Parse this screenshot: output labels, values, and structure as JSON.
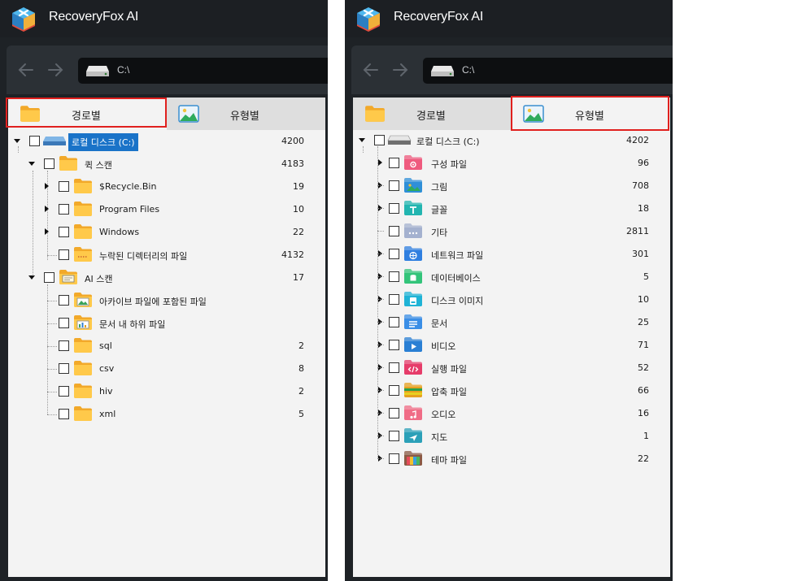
{
  "app": {
    "title": "RecoveryFox AI"
  },
  "path": {
    "text": "C:\\"
  },
  "tabs": {
    "by_path": "경로별",
    "by_type": "유형별"
  },
  "colors": {
    "highlight": "#e0201e",
    "selection": "#1a73c8",
    "folder": "#f5b82e"
  },
  "left_tree": {
    "root": {
      "label": "로컬 디스크 (C:)",
      "count": "4200"
    },
    "quick_scan": {
      "label": "퀵 스캔",
      "count": "4183"
    },
    "quick_items": [
      {
        "label": "$Recycle.Bin",
        "count": "19"
      },
      {
        "label": "Program Files",
        "count": "10"
      },
      {
        "label": "Windows",
        "count": "22"
      },
      {
        "label": "누락된 디렉터리의 파일",
        "count": "4132"
      }
    ],
    "ai_scan": {
      "label": "AI 스캔",
      "count": "17"
    },
    "ai_items": [
      {
        "label": "아카이브 파일에 포함된 파일",
        "count": ""
      },
      {
        "label": "문서 내 하위 파일",
        "count": ""
      },
      {
        "label": "sql",
        "count": "2"
      },
      {
        "label": "csv",
        "count": "8"
      },
      {
        "label": "hiv",
        "count": "2"
      },
      {
        "label": "xml",
        "count": "5"
      }
    ]
  },
  "right_tree": {
    "root": {
      "label": "로컬 디스크 (C:)",
      "count": "4202"
    },
    "items": [
      {
        "label": "구성 파일",
        "count": "96",
        "icon": "settings-folder-icon",
        "color": "#ef5a7e"
      },
      {
        "label": "그림",
        "count": "708",
        "icon": "picture-folder-icon",
        "color": "#2f8fd8"
      },
      {
        "label": "글꼴",
        "count": "18",
        "icon": "font-folder-icon",
        "color": "#22b5b0"
      },
      {
        "label": "기타",
        "count": "2811",
        "icon": "other-folder-icon",
        "color": "#a4b1cf"
      },
      {
        "label": "네트워크 파일",
        "count": "301",
        "icon": "network-folder-icon",
        "color": "#2f7fe0"
      },
      {
        "label": "데이터베이스",
        "count": "5",
        "icon": "database-folder-icon",
        "color": "#33c47a"
      },
      {
        "label": "디스크 이미지",
        "count": "10",
        "icon": "disk-image-folder-icon",
        "color": "#1fb3d6"
      },
      {
        "label": "문서",
        "count": "25",
        "icon": "document-folder-icon",
        "color": "#3a8ee6"
      },
      {
        "label": "비디오",
        "count": "71",
        "icon": "video-folder-icon",
        "color": "#2a7fd4"
      },
      {
        "label": "실행 파일",
        "count": "52",
        "icon": "executable-folder-icon",
        "color": "#e63c6a"
      },
      {
        "label": "압축 파일",
        "count": "66",
        "icon": "archive-folder-icon",
        "color": "#e6a020"
      },
      {
        "label": "오디오",
        "count": "16",
        "icon": "audio-folder-icon",
        "color": "#f06c86"
      },
      {
        "label": "지도",
        "count": "1",
        "icon": "map-folder-icon",
        "color": "#2ba0b8"
      },
      {
        "label": "테마 파일",
        "count": "22",
        "icon": "theme-folder-icon",
        "color": "#8a5a44"
      }
    ]
  }
}
